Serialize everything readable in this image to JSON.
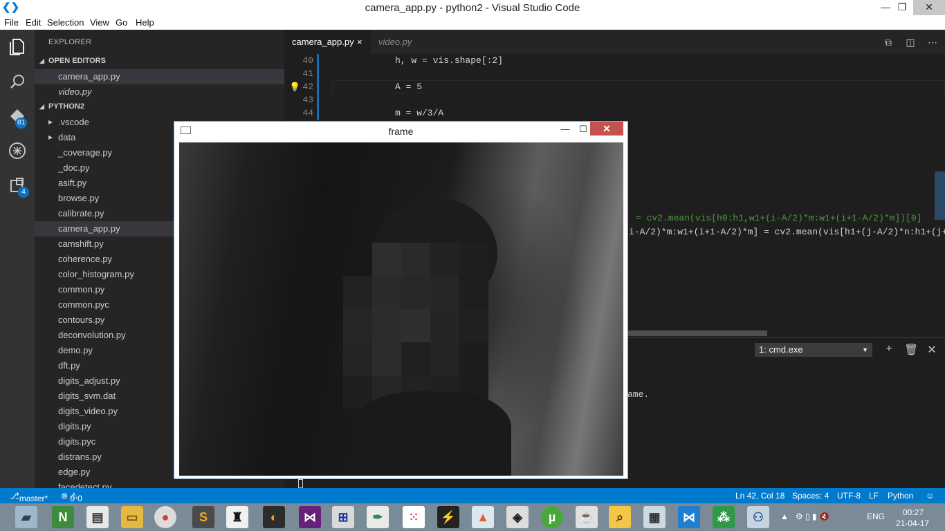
{
  "window": {
    "title": "camera_app.py - python2 - Visual Studio Code",
    "controls": [
      "minimize",
      "restore",
      "close"
    ]
  },
  "menu": [
    "File",
    "Edit",
    "Selection",
    "View",
    "Go",
    "Help"
  ],
  "activity_bar": {
    "items": [
      {
        "name": "explorer",
        "icon": "files-icon"
      },
      {
        "name": "search",
        "icon": "search-icon"
      },
      {
        "name": "source-control",
        "icon": "git-icon",
        "badge": "81"
      },
      {
        "name": "debug",
        "icon": "debug-icon"
      },
      {
        "name": "extensions",
        "icon": "extensions-icon",
        "badge": "4"
      }
    ]
  },
  "sidebar": {
    "header": "EXPLORER",
    "open_editors_label": "OPEN EDITORS",
    "open_editors": [
      "camera_app.py",
      "video.py"
    ],
    "folder_label": "PYTHON2",
    "files": [
      ".vscode",
      "data",
      "_coverage.py",
      "_doc.py",
      "asift.py",
      "browse.py",
      "calibrate.py",
      "camera_app.py",
      "camshift.py",
      "coherence.py",
      "color_histogram.py",
      "common.py",
      "common.pyc",
      "contours.py",
      "deconvolution.py",
      "demo.py",
      "dft.py",
      "digits_adjust.py",
      "digits_svm.dat",
      "digits_video.py",
      "digits.py",
      "digits.pyc",
      "distrans.py",
      "edge.py",
      "facedetect.py"
    ],
    "selected_file": "camera_app.py"
  },
  "tabs": [
    {
      "label": "camera_app.py",
      "active": true,
      "close": "×"
    },
    {
      "label": "video.py",
      "active": false
    }
  ],
  "editor": {
    "lines": [
      {
        "num": "40",
        "text": "h, w = vis.shape[:2]"
      },
      {
        "num": "41",
        "text": ""
      },
      {
        "num": "42",
        "text": "A = 5"
      },
      {
        "num": "43",
        "text": ""
      },
      {
        "num": "44",
        "text": "m = w/3/A"
      }
    ],
    "fragments": [
      "= cv2.mean(vis[h0:h1,w1+(i-A/2)*m:w1+(i+1-A/2)*m])[0]",
      "i-A/2)*m:w1+(i+1-A/2)*m] = cv2.mean(vis[h1+(j-A/2)*n:h1+(j+"
    ]
  },
  "panel": {
    "terminal_select": "1: cmd.exe",
    "output_fragment": "ame."
  },
  "statusbar": {
    "branch": "master*",
    "errors": "0",
    "warnings": "0",
    "position": "Ln 42, Col 18",
    "spaces": "Spaces: 4",
    "encoding": "UTF-8",
    "eol": "LF",
    "language": "Python"
  },
  "frame_window": {
    "title": "frame"
  },
  "taskbar": {
    "language": "ENG",
    "time": "00:27",
    "date": "21-04-17"
  }
}
